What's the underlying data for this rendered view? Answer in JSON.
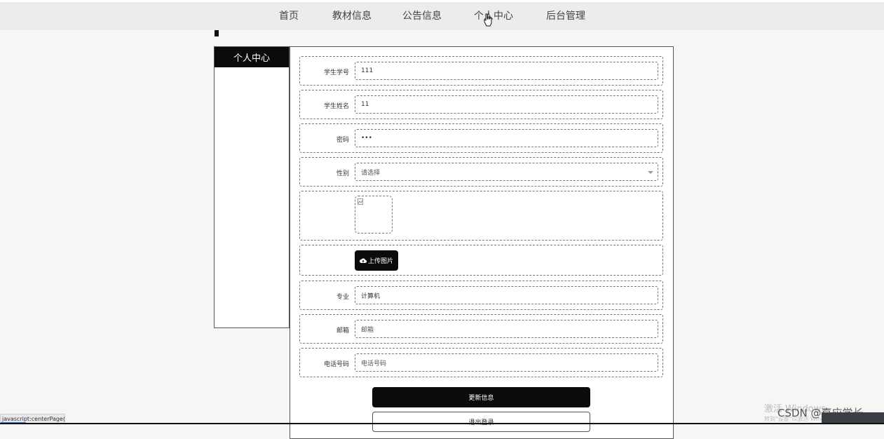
{
  "nav": {
    "items": [
      "首页",
      "教材信息",
      "公告信息",
      "个人中心",
      "后台管理"
    ]
  },
  "sidebar": {
    "title": "个人中心"
  },
  "form": {
    "student_id": {
      "label": "学生学号",
      "value": "111"
    },
    "student_name": {
      "label": "学生姓名",
      "value": "11"
    },
    "password": {
      "label": "密码",
      "value": "•••"
    },
    "gender": {
      "label": "性别",
      "value": "请选择"
    },
    "major": {
      "label": "专业",
      "value": "计算机"
    },
    "email": {
      "label": "邮箱",
      "placeholder": "邮箱"
    },
    "phone": {
      "label": "电话号码",
      "placeholder": "电话号码"
    },
    "upload_label": "上传图片",
    "update_button": "更新信息",
    "logout_button": "退出登录"
  },
  "statusbar": {
    "text": "javascript:centerPage();"
  },
  "os": {
    "activate_text": "激活 Windows",
    "activate_sub": "转到\"设置\"以激活 Windows。"
  },
  "watermark": "CSDN @嘉应学长",
  "colors": {
    "primary": "#0b0b0b",
    "nav_bg": "#ececec",
    "page_bg": "#f6f6f6"
  },
  "icons": {
    "cursor": "hand-pointer-icon",
    "upload": "cloud-upload-icon",
    "image": "broken-image-icon",
    "dropdown": "chevron-down-icon"
  }
}
